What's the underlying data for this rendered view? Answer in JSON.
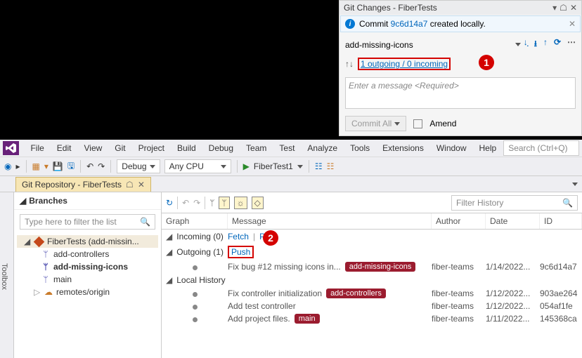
{
  "gitPanel": {
    "title": "Git Changes - FiberTests",
    "info_pre": "Commit ",
    "info_hash": "9c6d14a7",
    "info_post": " created locally.",
    "branch": "add-missing-icons",
    "outgoing": "1 outgoing / 0 incoming",
    "msgPlaceholder": "Enter a message <Required>",
    "commitBtn": "Commit All",
    "amend": "Amend"
  },
  "badges": {
    "one": "1",
    "two": "2"
  },
  "menu": [
    "File",
    "Edit",
    "View",
    "Git",
    "Project",
    "Build",
    "Debug",
    "Team",
    "Test",
    "Analyze",
    "Tools",
    "Extensions",
    "Window",
    "Help"
  ],
  "searchPlaceholder": "Search (Ctrl+Q)",
  "toolbar": {
    "config": "Debug",
    "platform": "Any CPU",
    "run": "FiberTest1"
  },
  "tab": "Git Repository - FiberTests",
  "vside": "Toolbox",
  "branches": {
    "title": "Branches",
    "filter": "Type here to filter the list",
    "repo": "FiberTests (add-missin...",
    "items": [
      "add-controllers",
      "add-missing-icons",
      "main",
      "remotes/origin"
    ]
  },
  "history": {
    "filter": "Filter History",
    "cols": {
      "graph": "Graph",
      "msg": "Message",
      "author": "Author",
      "date": "Date",
      "id": "ID"
    },
    "incoming": "Incoming (0)",
    "fetch": "Fetch",
    "pull": "Pull",
    "outgoing": "Outgoing (1)",
    "push": "Push",
    "local": "Local History",
    "rows": [
      {
        "msg": "Fix bug #12 missing icons in...",
        "tag": "add-missing-icons",
        "author": "fiber-teams",
        "date": "1/14/2022...",
        "id": "9c6d14a7"
      },
      {
        "msg": "Fix controller initialization",
        "tag": "add-controllers",
        "author": "fiber-teams",
        "date": "1/12/2022...",
        "id": "903ae264"
      },
      {
        "msg": "Add test controller",
        "tag": "",
        "author": "fiber-teams",
        "date": "1/12/2022...",
        "id": "054af1fe"
      },
      {
        "msg": "Add project files.",
        "tag": "main",
        "author": "fiber-teams",
        "date": "1/11/2022...",
        "id": "145368ca"
      }
    ]
  }
}
